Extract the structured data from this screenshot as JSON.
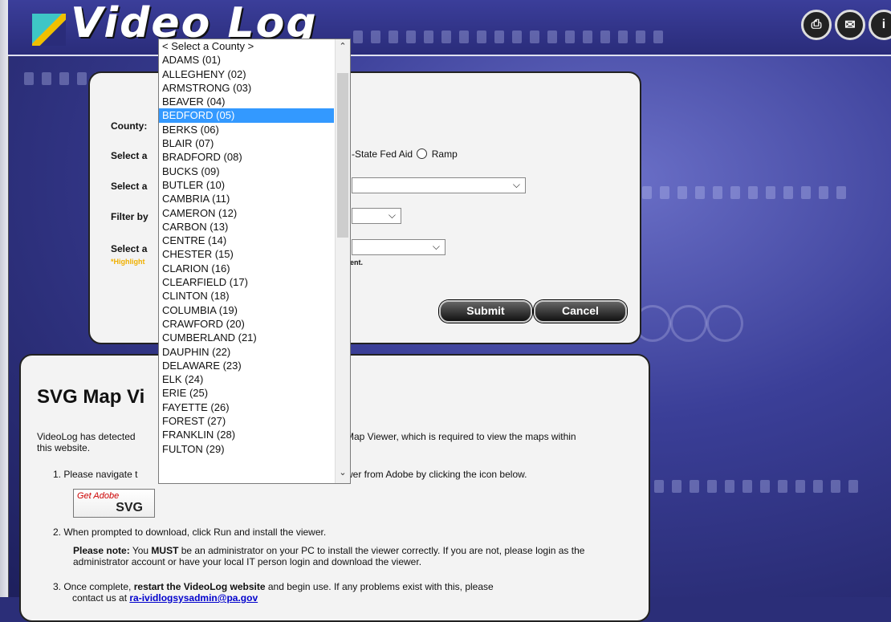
{
  "app": {
    "title": "Video Log"
  },
  "toolbar": {
    "icons": [
      "print-icon",
      "mail-icon",
      "info-icon"
    ]
  },
  "form": {
    "county_label": "County:",
    "select_label_1": "Select a",
    "radio_text": "-State Fed Aid",
    "ramp_label": "Ramp",
    "select_label_2": "Select a",
    "filter_label": "Filter by",
    "select_label_3": "Select a",
    "note_highlight": "*Highlight",
    "note_tail": "ent.",
    "submit_label": "Submit",
    "cancel_label": "Cancel"
  },
  "county_dropdown": {
    "placeholder": "< Select a County >",
    "selected": "BEDFORD (05)",
    "options": [
      "< Select a County >",
      "ADAMS (01)",
      "ALLEGHENY (02)",
      "ARMSTRONG (03)",
      "BEAVER (04)",
      "BEDFORD (05)",
      "BERKS (06)",
      "BLAIR (07)",
      "BRADFORD (08)",
      "BUCKS (09)",
      "BUTLER (10)",
      "CAMBRIA (11)",
      "CAMERON (12)",
      "CARBON (13)",
      "CENTRE (14)",
      "CHESTER (15)",
      "CLARION (16)",
      "CLEARFIELD (17)",
      "CLINTON (18)",
      "COLUMBIA (19)",
      "CRAWFORD (20)",
      "CUMBERLAND (21)",
      "DAUPHIN (22)",
      "DELAWARE (23)",
      "ELK (24)",
      "ERIE (25)",
      "FAYETTE (26)",
      "FOREST (27)",
      "FRANKLIN (28)",
      "FULTON (29)"
    ]
  },
  "svg_panel": {
    "heading": "SVG Map Vi",
    "intro_left": "VideoLog has detected",
    "intro_left2": "this website.",
    "intro_right": "Map Viewer, which is required to view the maps within",
    "step1_prefix": "1.  Please navigate t",
    "step1_suffix": "wer from Adobe by clicking the icon below.",
    "badge_get": "Get Adobe",
    "badge_svg": "SVG",
    "step2": "2.  When prompted to download, click Run and install the viewer.",
    "note_bold": "Please note:",
    "note_text": " You ",
    "note_must": "MUST",
    "note_rest": " be an administrator on your PC to install the viewer correctly. If you are not, please login as the administrator account or have your local IT person login and download the viewer.",
    "step3_a": "3.  Once complete, ",
    "step3_b": "restart the VideoLog website",
    "step3_c": " and begin use. If any problems exist with this, please",
    "step3_d": "contact us at ",
    "email": "ra-ividlogsysadmin@pa.gov"
  }
}
